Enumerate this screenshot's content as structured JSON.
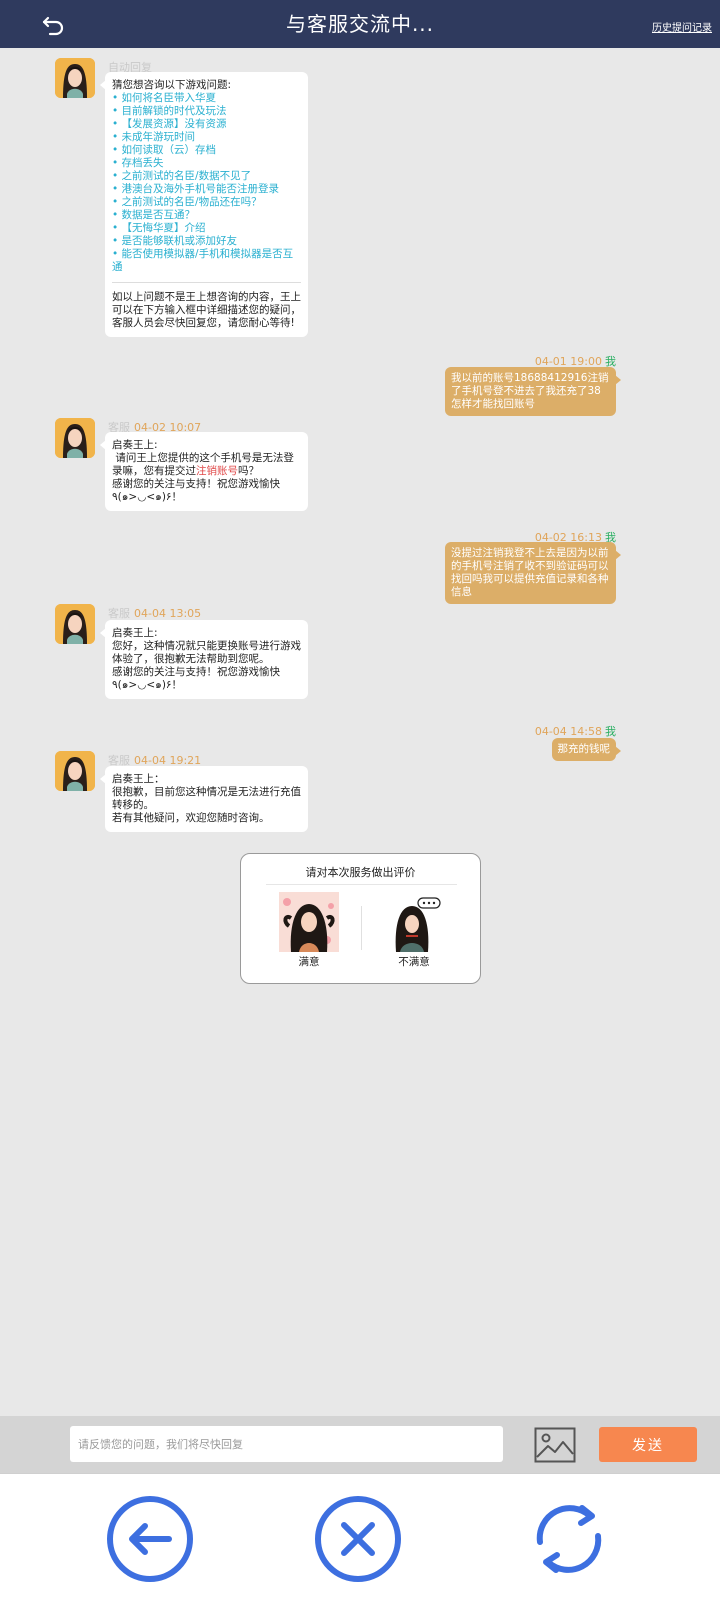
{
  "header": {
    "title": "与客服交流中...",
    "history_link": "历史提问记录"
  },
  "auto_reply": {
    "sender": "自动回复",
    "intro": "猜您想咨询以下游戏问题:",
    "items": [
      "如何将名臣带入华夏",
      "目前解锁的时代及玩法",
      "【发展资源】没有资源",
      "未成年游玩时间",
      "如何读取（云）存档",
      "存档丢失",
      "之前测试的名臣/数据不见了",
      "港澳台及海外手机号能否注册登录",
      "之前测试的名臣/物品还在吗？",
      "数据是否互通？",
      "【无悔华夏】介绍",
      "是否能够联机或添加好友",
      "能否使用模拟器/手机和模拟器是否互通"
    ],
    "footer": "如以上问题不是王上想咨询的内容，王上可以在下方输入框中详细描述您的疑问，客服人员会尽快回复您，请您耐心等待!"
  },
  "messages": [
    {
      "side": "right",
      "time": "04-01 19:00",
      "who": "我",
      "text": "我以前的账号18688412916注销了手机号登不进去了我还充了38怎样才能找回账号"
    },
    {
      "side": "left",
      "sender": "客服",
      "time": "04-02 10:07",
      "line1": "启奏王上:",
      "line2a": "请问王上您提供的这个手机号是无法登录嘛，您有提交过",
      "line2_link": "注销账号",
      "line2b": "吗？",
      "line3": "感谢您的关注与支持！祝您游戏愉快٩(๑>◡<๑)۶！"
    },
    {
      "side": "right",
      "time": "04-02 16:13",
      "who": "我",
      "text": "没提过注销我登不上去是因为以前的手机号注销了收不到验证码可以找回吗我可以提供充值记录和各种信息"
    },
    {
      "side": "left",
      "sender": "客服",
      "time": "04-04 13:05",
      "line1": "启奏王上:",
      "line2": "您好，这种情况就只能更换账号进行游戏体验了，很抱歉无法帮助到您呢。",
      "line3": "感谢您的关注与支持！祝您游戏愉快٩(๑>◡<๑)۶！"
    },
    {
      "side": "right",
      "time": "04-04 14:58",
      "who": "我",
      "text": "那充的钱呢"
    },
    {
      "side": "left",
      "sender": "客服",
      "time": "04-04 19:21",
      "line1": "启奏王上：",
      "line2": "很抱歉，目前您这种情况是无法进行充值转移的。",
      "line3": "若有其他疑问，欢迎您随时咨询。"
    }
  ],
  "rating": {
    "title": "请对本次服务做出评价",
    "satisfied": "满意",
    "unsatisfied": "不满意"
  },
  "input": {
    "placeholder": "请反馈您的问题，我们将尽快回复",
    "value": "",
    "send_label": "发送"
  },
  "colors": {
    "header_bg": "#2f3a5e",
    "chat_bg": "#e8e8e8",
    "user_bubble": "#dcae68",
    "link": "#2ab0d0",
    "send_button": "#f7874f",
    "nav_icon": "#3d6fe0"
  },
  "nav": {
    "back_icon": "arrow-left-circle-icon",
    "close_icon": "close-circle-icon",
    "refresh_icon": "refresh-icon"
  }
}
